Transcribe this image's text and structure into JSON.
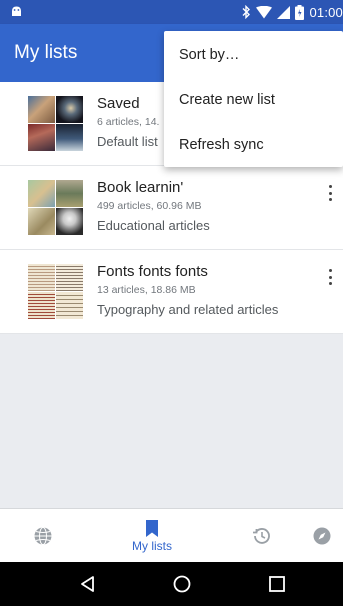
{
  "status_bar": {
    "time": "01:00",
    "icons": [
      "android-icon",
      "bluetooth-icon",
      "wifi-icon",
      "signal-icon",
      "battery-icon"
    ]
  },
  "app_bar": {
    "title": "My lists"
  },
  "menu": {
    "items": [
      {
        "label": "Sort by…"
      },
      {
        "label": "Create new list"
      },
      {
        "label": "Refresh sync"
      }
    ]
  },
  "lists": [
    {
      "name": "Saved",
      "meta": "6 articles, 14.",
      "desc": "Default list"
    },
    {
      "name": "Book learnin'",
      "meta": "499 articles, 60.96 MB",
      "desc": "Educational articles"
    },
    {
      "name": "Fonts fonts fonts",
      "meta": "13 articles, 18.86 MB",
      "desc": "Typography and related articles"
    }
  ],
  "bottom_nav": {
    "items": [
      {
        "icon": "globe-icon",
        "label": ""
      },
      {
        "icon": "bookmark-icon",
        "label": "My lists"
      },
      {
        "icon": "history-icon",
        "label": ""
      },
      {
        "icon": "compass-icon",
        "label": ""
      }
    ]
  },
  "colors": {
    "accent": "#3366cc",
    "status_bar": "#2c56b4"
  }
}
